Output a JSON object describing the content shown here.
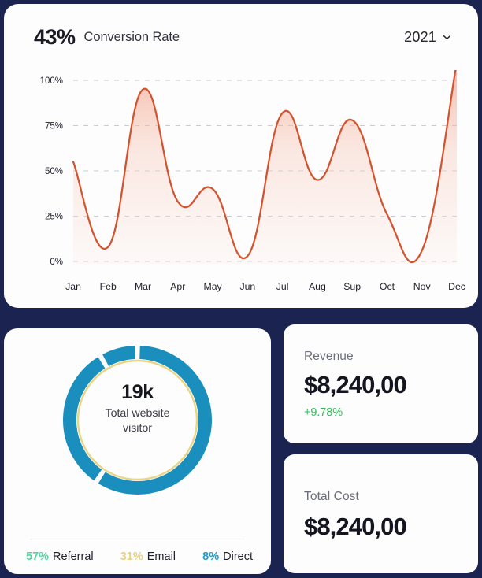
{
  "theme": {
    "page_background": "#1b2350",
    "card_background": "#fdfdfd",
    "line_color": "#d4532f",
    "area_fill_top": "#f2a68e",
    "area_fill_bottom": "#fdf2ee",
    "grid_color": "#c9cad2",
    "donut_teal": "#1a8fbe",
    "donut_gold": "#e9d583",
    "green_positive": "#2fc05a",
    "legend_green": "#55d6a0",
    "legend_gold": "#e6d382",
    "legend_teal": "#1b9ec7"
  },
  "chart_card": {
    "kpi_percent": "43%",
    "kpi_title": "Conversion Rate",
    "year_selector": {
      "value": "2021",
      "icon": "chevron-down-icon"
    }
  },
  "chart_data": {
    "type": "area",
    "title": "Conversion Rate",
    "xlabel": "",
    "ylabel": "",
    "ylim": [
      0,
      100
    ],
    "xlim": [
      "Jan",
      "Dec"
    ],
    "grid": true,
    "legend": "none",
    "y_ticks": [
      "0%",
      "25%",
      "50%",
      "75%",
      "100%"
    ],
    "y_tick_values": [
      0,
      25,
      50,
      75,
      100
    ],
    "categories": [
      "Jan",
      "Feb",
      "Mar",
      "Apr",
      "May",
      "Jun",
      "Jul",
      "Aug",
      "Sup",
      "Oct",
      "Nov",
      "Dec"
    ],
    "series": [
      {
        "name": "Conversion Rate",
        "values": [
          55,
          8,
          95,
          33,
          40,
          3,
          82,
          45,
          78,
          26,
          6,
          110
        ]
      }
    ],
    "annotations": []
  },
  "donut_card": {
    "center_value": "19k",
    "center_caption": "Total website visitor",
    "chart_data": {
      "type": "pie",
      "title": "Total website visitor",
      "center_label": "19k",
      "labels": [
        "Referral",
        "Email",
        "Direct"
      ],
      "values": [
        57,
        31,
        8
      ],
      "value_labels": [
        "57%",
        "31%",
        "8%"
      ],
      "colors": [
        "#55d6a0",
        "#e6d382",
        "#1b9ec7"
      ],
      "legend": "bottom"
    },
    "legend": [
      {
        "percent": "57%",
        "name": "Referral",
        "color": "#55d6a0"
      },
      {
        "percent": "31%",
        "name": "Email",
        "color": "#e6d382"
      },
      {
        "percent": "8%",
        "name": "Direct",
        "color": "#1b9ec7"
      }
    ]
  },
  "stats": [
    {
      "label": "Revenue",
      "value": "$8,240,00",
      "delta": "+9.78%",
      "delta_color": "#2fc05a"
    },
    {
      "label": "Total Cost",
      "value": "$8,240,00",
      "delta": "",
      "delta_color": ""
    }
  ]
}
